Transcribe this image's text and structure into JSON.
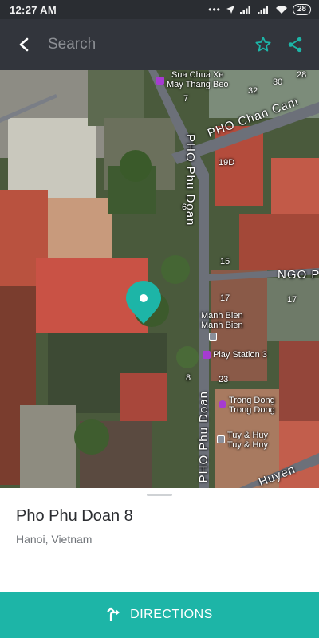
{
  "status_bar": {
    "time": "12:27 AM",
    "overflow": "•••",
    "battery": "28",
    "icons": [
      "location-arrow-icon",
      "signal-icon",
      "signal-icon",
      "wifi-icon",
      "battery-icon"
    ]
  },
  "app_bar": {
    "back_icon": "back-arrow-icon",
    "search_placeholder": "Search",
    "favorite_icon": "star-outline-icon",
    "share_icon": "share-icon"
  },
  "colors": {
    "accent": "#1db5a7",
    "app_bar": "#32353c",
    "status_bar": "#2a2d32",
    "poi_purple": "#a63bd1"
  },
  "map": {
    "streets": [
      "PHO Chan Cam",
      "PHO Phu Doan",
      "NGO P",
      "Huyen",
      "PHO Phu Doan"
    ],
    "house_numbers": [
      "28",
      "30",
      "32",
      "7",
      "19D",
      "6",
      "15",
      "17",
      "17",
      "8",
      "23"
    ],
    "pois": [
      {
        "name": "Sua Chua Xe\nMay Thang Beo",
        "icon": "shop-icon"
      },
      {
        "name": "Manh Bien\nManh Bien",
        "icon": "building-icon"
      },
      {
        "name": "Play Station 3",
        "icon": "shop-icon"
      },
      {
        "name": "Trong Dong\nTrong Dong",
        "icon": "camera-icon"
      },
      {
        "name": "Tuy & Huy\nTuy & Huy",
        "icon": "building-icon"
      }
    ],
    "marker_icon": "location-pin-icon"
  },
  "place": {
    "title": "Pho Phu Doan 8",
    "subtitle": "Hanoi, Vietnam"
  },
  "directions": {
    "label": "DIRECTIONS",
    "icon": "directions-icon"
  }
}
